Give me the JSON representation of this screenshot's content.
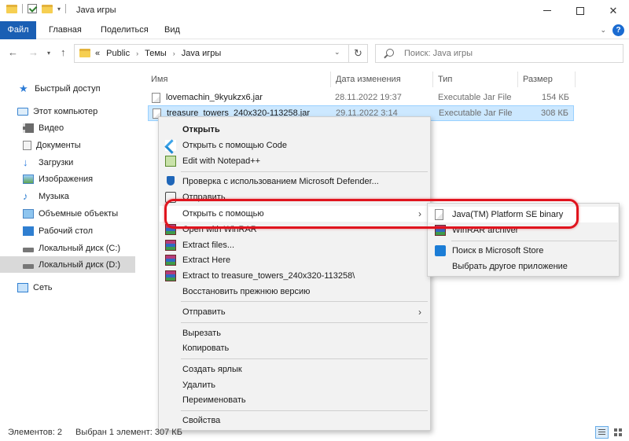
{
  "window": {
    "title": "Java игры",
    "controls": [
      "minimize-icon",
      "maximize-icon",
      "close-icon"
    ],
    "close_glyph": "✕"
  },
  "ribbon": {
    "tabs": [
      "Файл",
      "Главная",
      "Поделиться",
      "Вид"
    ],
    "accent": "#1a5fb4",
    "help_glyph": "?"
  },
  "address": {
    "prefix": "«",
    "crumbs": [
      "Public",
      "Темы",
      "Java игры"
    ],
    "search_placeholder": "Поиск: Java игры"
  },
  "nav": {
    "items": [
      {
        "label": "Быстрый доступ",
        "icon": "star-icon"
      },
      {
        "label": "Этот компьютер",
        "icon": "computer-icon"
      },
      {
        "label": "Видео",
        "icon": "video-icon"
      },
      {
        "label": "Документы",
        "icon": "documents-icon"
      },
      {
        "label": "Загрузки",
        "icon": "downloads-icon"
      },
      {
        "label": "Изображения",
        "icon": "pictures-icon"
      },
      {
        "label": "Музыка",
        "icon": "music-icon"
      },
      {
        "label": "Объемные объекты",
        "icon": "3d-objects-icon"
      },
      {
        "label": "Рабочий стол",
        "icon": "desktop-icon"
      },
      {
        "label": "Локальный диск (C:)",
        "icon": "drive-icon"
      },
      {
        "label": "Локальный диск (D:)",
        "icon": "drive-icon",
        "selected": true
      },
      {
        "label": "Сеть",
        "icon": "network-icon"
      }
    ]
  },
  "files": {
    "columns": [
      "Имя",
      "Дата изменения",
      "Тип",
      "Размер"
    ],
    "rows": [
      {
        "name": "lovemachin_9kyukzx6.jar",
        "date": "28.11.2022 19:37",
        "type": "Executable Jar File",
        "size": "154 КБ"
      },
      {
        "name": "treasure_towers_240x320-113258.jar",
        "date": "29.11.2022 3:14",
        "type": "Executable Jar File",
        "size": "308 КБ",
        "selected": true
      }
    ]
  },
  "context_menu": {
    "items": [
      "Открыть",
      "Открыть с помощью Code",
      "Edit with Notepad++",
      "Проверка с использованием Microsoft Defender...",
      "Отправить",
      "Открыть с помощью",
      "Open with WinRAR",
      "Extract files...",
      "Extract Here",
      "Extract to treasure_towers_240x320-113258\\",
      "Восстановить прежнюю версию",
      "Отправить",
      "Вырезать",
      "Копировать",
      "Создать ярлык",
      "Удалить",
      "Переименовать",
      "Свойства"
    ]
  },
  "submenu": {
    "items": [
      "Java(TM) Platform SE binary",
      "WinRAR archiver",
      "Поиск в Microsoft Store",
      "Выбрать другое приложение"
    ]
  },
  "highlight_color": "#e0141e",
  "status": {
    "count": "Элементов: 2",
    "selected": "Выбран 1 элемент: 307 КБ"
  }
}
